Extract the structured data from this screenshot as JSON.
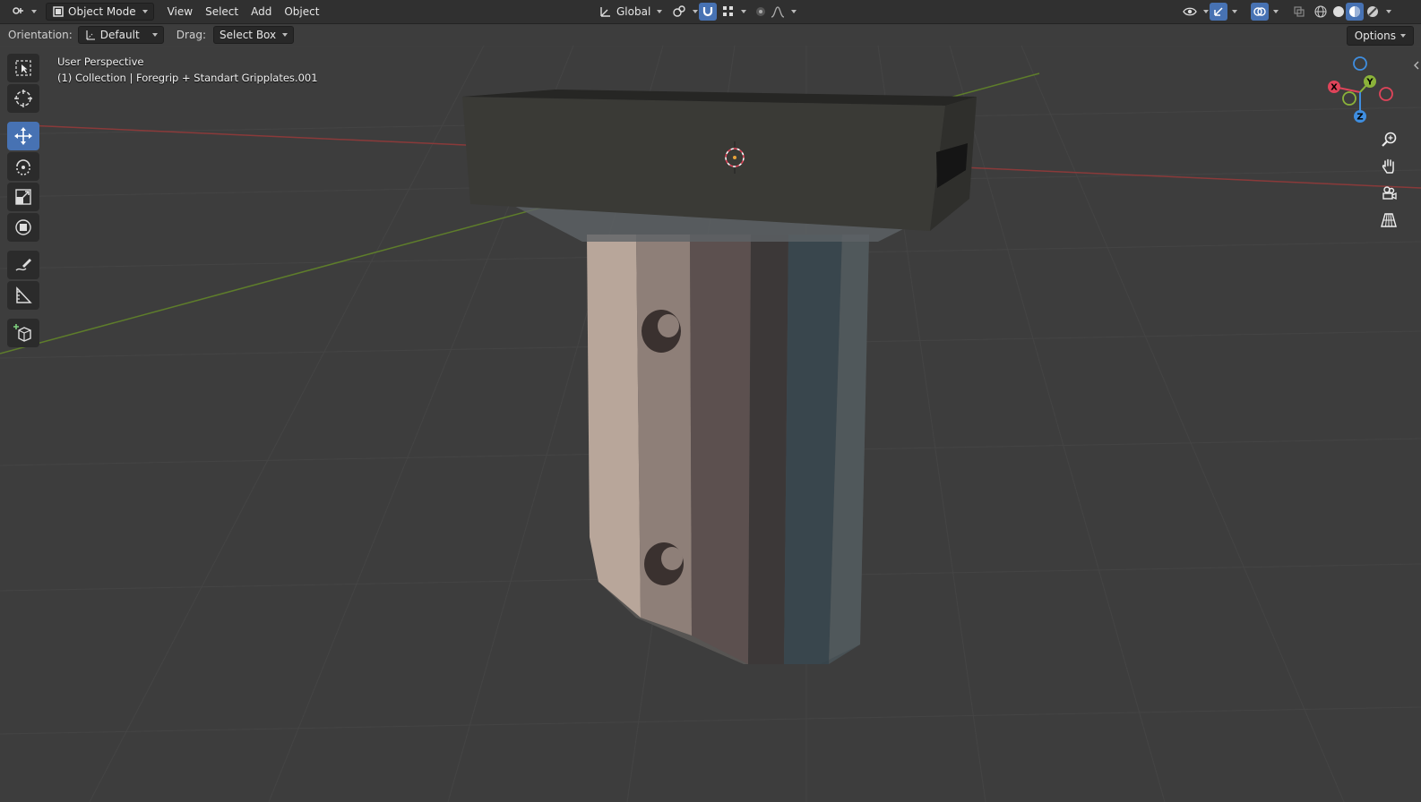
{
  "header": {
    "mode_label": "Object Mode",
    "menus": [
      "View",
      "Select",
      "Add",
      "Object"
    ],
    "transform_orientation": "Global"
  },
  "subheader": {
    "orientation_label": "Orientation:",
    "orientation_value": "Default",
    "drag_label": "Drag:",
    "drag_value": "Select Box",
    "options_label": "Options"
  },
  "viewport": {
    "view_name": "User Perspective",
    "collection_info": "(1) Collection | Foregrip + Standart Gripplates.001"
  },
  "gizmo": {
    "x_label": "X",
    "y_label": "Y",
    "z_label": "Z",
    "colors": {
      "x": "#e0445a",
      "y": "#8bb33a",
      "z": "#3f8ee0"
    }
  },
  "colors": {
    "accent": "#4772b3",
    "grid_x_axis": "#8a3a3a",
    "grid_y_axis": "#5e7d2b"
  }
}
